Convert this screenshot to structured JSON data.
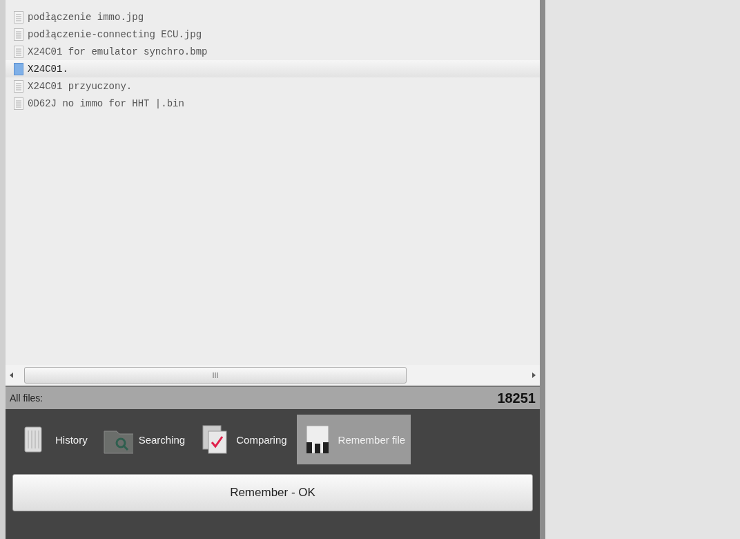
{
  "files": [
    {
      "name": "podłączenie immo.jpg",
      "selected": false
    },
    {
      "name": "podłączenie-connecting ECU.jpg",
      "selected": false
    },
    {
      "name": "X24C01 for emulator synchro.bmp",
      "selected": false
    },
    {
      "name": "X24C01.",
      "selected": true
    },
    {
      "name": "X24C01 przyuczony.",
      "selected": false
    },
    {
      "name": "0D62J no immo for HHT |.bin",
      "selected": false
    }
  ],
  "status_bar": {
    "label": "All files:",
    "count": "18251"
  },
  "tabs": [
    {
      "label": "History",
      "kind": "history",
      "selected": false
    },
    {
      "label": "Searching",
      "kind": "search",
      "selected": false
    },
    {
      "label": "Comparing",
      "kind": "compare",
      "selected": false
    },
    {
      "label": "Remember file",
      "kind": "remember",
      "selected": true
    }
  ],
  "action_button": "Remember - OK"
}
